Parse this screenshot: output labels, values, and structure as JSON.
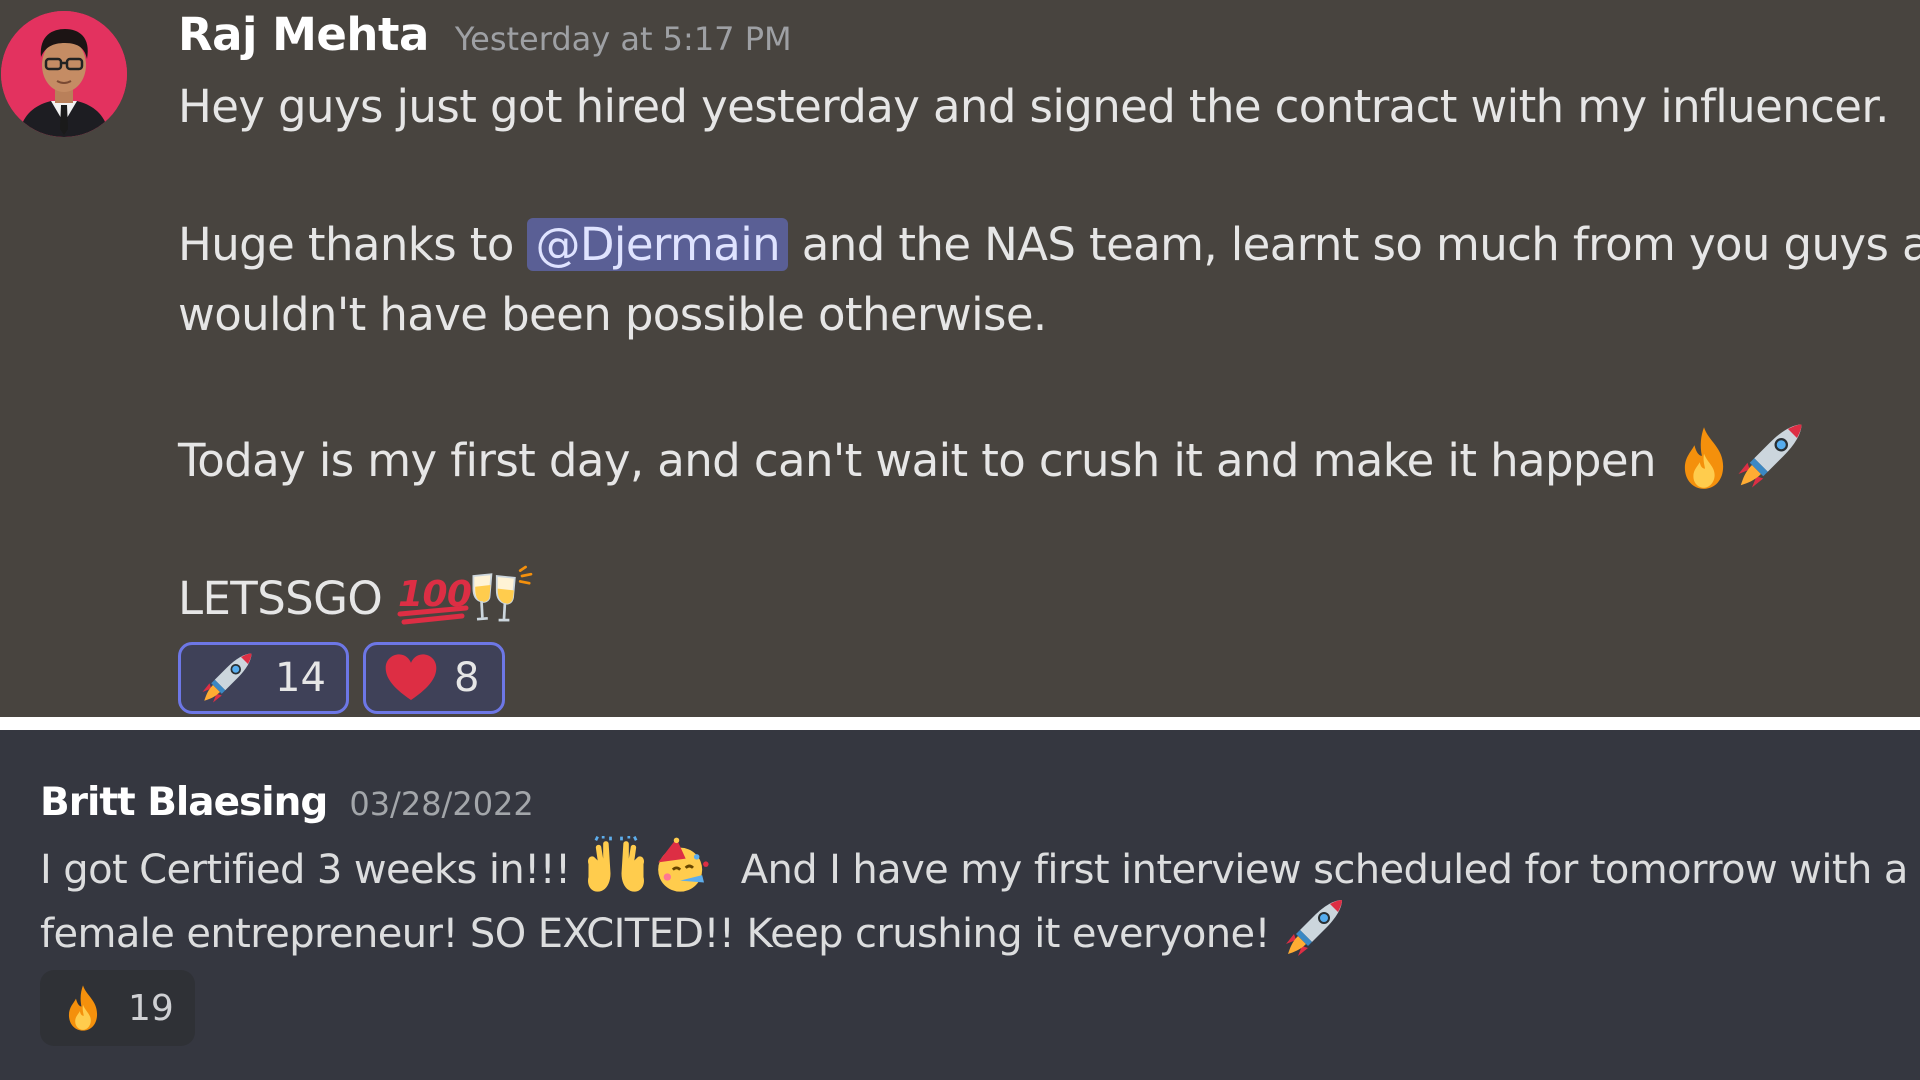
{
  "message1": {
    "username": "Raj Mehta",
    "timestamp": "Yesterday at 5:17 PM",
    "line1": "Hey guys just got hired yesterday and signed the contract with my influencer.",
    "line2_before": "Huge thanks to",
    "mention": "@Djermain",
    "line2_after": "and the NAS team, learnt so much from you guys and",
    "line3": "wouldn't have been possible otherwise.",
    "line4": "Today is my first day, and can't wait to crush it and make it happen",
    "line5": "LETSSGO",
    "reactions": [
      {
        "emoji": "rocket-icon",
        "count": "14"
      },
      {
        "emoji": "heart-icon",
        "count": "8"
      }
    ]
  },
  "message2": {
    "username": "Britt Blaesing",
    "timestamp": "03/28/2022",
    "line1_part1": "I got Certified 3 weeks in!!!",
    "line1_part2": "And I have my first interview scheduled for tomorrow with a",
    "line2": "female entrepreneur! SO EXCITED!! Keep crushing it everyone!",
    "reactions": [
      {
        "emoji": "fire-icon",
        "count": "19"
      }
    ]
  },
  "colors": {
    "top_bg": "#48443f",
    "bottom_bg": "#353740",
    "mention_bg": "#5a5f95",
    "reaction_border": "#6d77e6",
    "avatar_bg": "#e3325f"
  }
}
